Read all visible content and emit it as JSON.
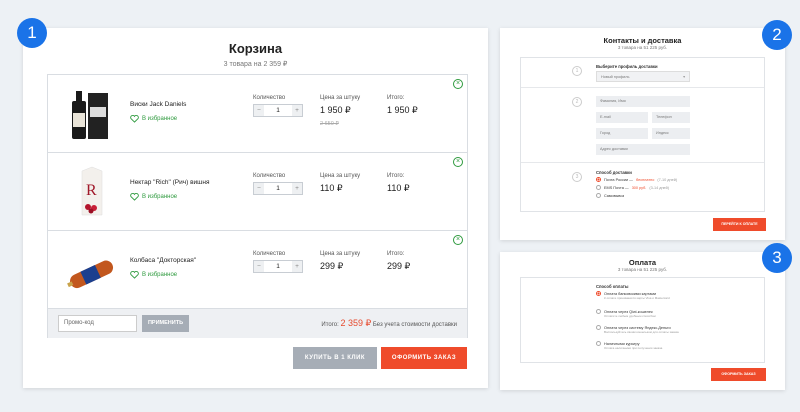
{
  "steps": [
    "1",
    "2",
    "3"
  ],
  "cart": {
    "title": "Корзина",
    "subtitle": "3 товара на 2 359 ₽",
    "col_labels": {
      "qty": "Количество",
      "price": "Цена за штуку",
      "total": "Итого:"
    },
    "favorite_label": "В избранное",
    "items": [
      {
        "name": "Виски Jack Daniels",
        "qty": "1",
        "price": "1 950 ₽",
        "old_price": "2 650 ₽",
        "total": "1 950 ₽",
        "image": "whisky-bottle"
      },
      {
        "name": "Нектар \"Rich\" (Рич) вишня",
        "qty": "1",
        "price": "110 ₽",
        "old_price": "",
        "total": "110 ₽",
        "image": "juice-carton"
      },
      {
        "name": "Колбаса \"Докторская\"",
        "qty": "1",
        "price": "299 ₽",
        "old_price": "",
        "total": "299 ₽",
        "image": "sausage"
      }
    ],
    "promo_placeholder": "Промо-код",
    "apply_label": "ПРИМЕНИТЬ",
    "sum_label": "Итого:",
    "sum_value": "2 359 ₽",
    "sum_note": "Без учета стоимости доставки",
    "oneclick_label": "КУПИТЬ В 1 КЛИК",
    "order_label": "ОФОРМИТЬ ЗАКАЗ"
  },
  "delivery": {
    "title": "Контакты и доставка",
    "subtitle": "3 товара на 51 225 руб.",
    "profile_label": "Выберите профиль доставки",
    "profile_value": "Новый профиль",
    "fields": {
      "name": "Фамилия, Имя",
      "email": "E-mail",
      "phone": "Телефон",
      "city": "Город",
      "index": "Индекс",
      "address": "Адрес доставки"
    },
    "method_label": "Способ доставки",
    "methods": [
      {
        "name": "Почта России —",
        "price": "бесплатно",
        "term": "(7-10 дней)"
      },
      {
        "name": "EMS Почта —",
        "price": "300 руб.",
        "term": "(3-14 дней)"
      },
      {
        "name": "Самовывоз",
        "price": "",
        "term": ""
      }
    ],
    "next_label": "ПЕРЕЙТИ К ОПЛАТЕ"
  },
  "payment": {
    "title": "Оплата",
    "subtitle": "3 товара на 51 225 руб.",
    "method_label": "Способ оплаты",
    "options": [
      {
        "name": "Оплата банковскими картами",
        "desc": "К оплате принимаются карты Visa и Mastercard"
      },
      {
        "name": "Оплата через Qiwi-кошелек",
        "desc": "Оплатите любым удобным способом"
      },
      {
        "name": "Оплата через систему Яндекс.Деньги",
        "desc": "Воспользуйтесь своим кошельком для оплаты заказа"
      },
      {
        "name": "Наличными курьеру",
        "desc": "Оплата наличными при получении заказа"
      }
    ],
    "submit_label": "ОФОРМИТЬ ЗАКАЗ"
  },
  "colors": {
    "step": "#1a73e8",
    "accent": "#ef4b2b",
    "green": "#2e9a3e",
    "gray_btn": "#a6adb6"
  }
}
